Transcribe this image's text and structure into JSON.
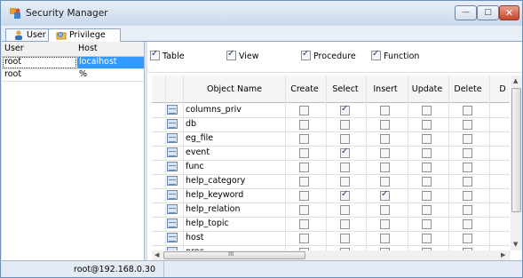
{
  "window": {
    "title": "Security Manager",
    "controls": [
      "minimize",
      "maximize",
      "close"
    ]
  },
  "tabs": [
    {
      "label": "User",
      "icon": "user-icon"
    },
    {
      "label": "Privilege",
      "icon": "privilege-icon",
      "active": true
    }
  ],
  "users": {
    "headers": [
      "User",
      "Host"
    ],
    "rows": [
      {
        "user": "root",
        "host": "localhost",
        "selected": true
      },
      {
        "user": "root",
        "host": "%"
      }
    ]
  },
  "filters": [
    {
      "label": "Table",
      "checked": true
    },
    {
      "label": "View",
      "checked": true
    },
    {
      "label": "Procedure",
      "checked": true
    },
    {
      "label": "Function",
      "checked": true
    }
  ],
  "grid": {
    "headers": [
      "Object Name",
      "Create",
      "Select",
      "Insert",
      "Update",
      "Delete",
      "D"
    ],
    "rows": [
      {
        "name": "columns_priv",
        "checks": [
          false,
          true,
          false,
          false,
          false
        ]
      },
      {
        "name": "db",
        "checks": [
          false,
          false,
          false,
          false,
          false
        ]
      },
      {
        "name": "eg_file",
        "checks": [
          false,
          false,
          false,
          false,
          false
        ]
      },
      {
        "name": "event",
        "checks": [
          false,
          true,
          false,
          false,
          false
        ]
      },
      {
        "name": "func",
        "checks": [
          false,
          false,
          false,
          false,
          false
        ]
      },
      {
        "name": "help_category",
        "checks": [
          false,
          false,
          false,
          false,
          false
        ]
      },
      {
        "name": "help_keyword",
        "checks": [
          false,
          true,
          true,
          false,
          false
        ]
      },
      {
        "name": "help_relation",
        "checks": [
          false,
          false,
          false,
          false,
          false
        ]
      },
      {
        "name": "help_topic",
        "checks": [
          false,
          false,
          false,
          false,
          false
        ]
      },
      {
        "name": "host",
        "checks": [
          false,
          false,
          false,
          false,
          false
        ]
      },
      {
        "name": "proc",
        "checks": [
          false,
          false,
          false,
          false,
          false
        ]
      }
    ],
    "hscroll_label": "III"
  },
  "status": {
    "connection": "root@192.168.0.30"
  },
  "colors": {
    "selection": "#3399ff",
    "close_button": "#c4462e",
    "frame": "#dce6f2"
  }
}
